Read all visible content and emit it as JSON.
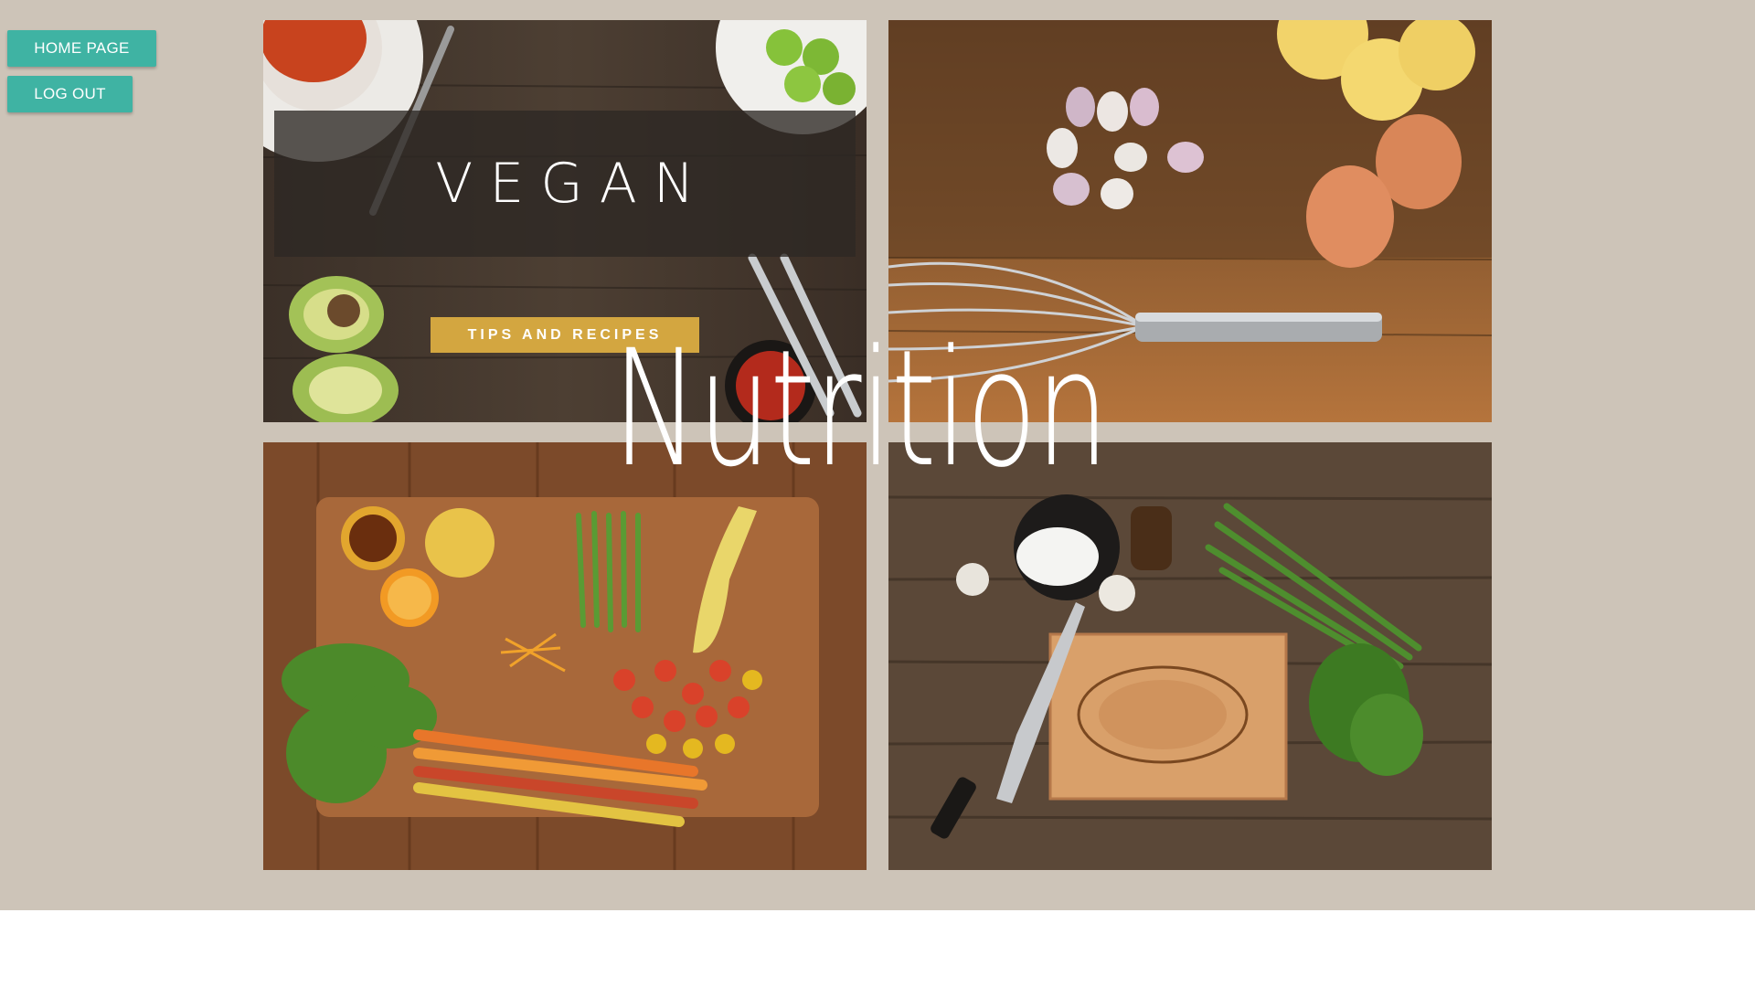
{
  "nav": {
    "home_label": "HOME PAGE",
    "logout_label": "LOG OUT"
  },
  "hero": {
    "title": "Nutrition"
  },
  "tiles": {
    "vegan": {
      "title": "VEGAN",
      "button_label": "TIPS AND RECIPES"
    }
  },
  "colors": {
    "page_background": "#cdc4b8",
    "nav_button": "#3fb3a3",
    "tips_button": "#d3a640"
  },
  "icons": {
    "tile_vegan": "food-photo-icon",
    "tile_eggs": "eggs-whisk-photo-icon",
    "tile_vegetables": "vegetables-board-photo-icon",
    "tile_pork": "pork-cutting-board-photo-icon"
  }
}
